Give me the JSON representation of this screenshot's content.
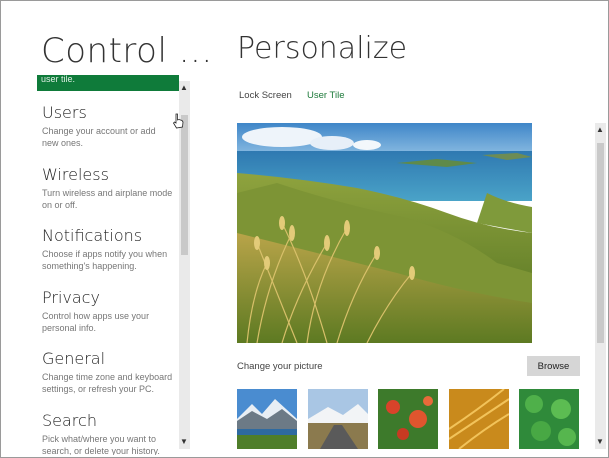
{
  "left": {
    "title": "Control ...",
    "selected_tail": "user tile.",
    "categories": [
      {
        "title": "Users",
        "desc": "Change your account or add new ones."
      },
      {
        "title": "Wireless",
        "desc": "Turn wireless and airplane mode on or off."
      },
      {
        "title": "Notifications",
        "desc": "Choose if apps notify you when something's happening."
      },
      {
        "title": "Privacy",
        "desc": "Control how apps use your personal info."
      },
      {
        "title": "General",
        "desc": "Change time zone and keyboard settings, or refresh your PC."
      },
      {
        "title": "Search",
        "desc": "Pick what/where you want to search, or delete your history."
      }
    ]
  },
  "right": {
    "title": "Personalize",
    "tabs": [
      {
        "label": "Lock Screen",
        "active": false
      },
      {
        "label": "User Tile",
        "active": true
      }
    ],
    "change_label": "Change your picture",
    "browse_label": "Browse"
  },
  "colors": {
    "accent": "#0f7b3a",
    "tab_active": "#1d7a3a"
  },
  "icons": {
    "scroll_up": "▲",
    "scroll_down": "▼"
  }
}
